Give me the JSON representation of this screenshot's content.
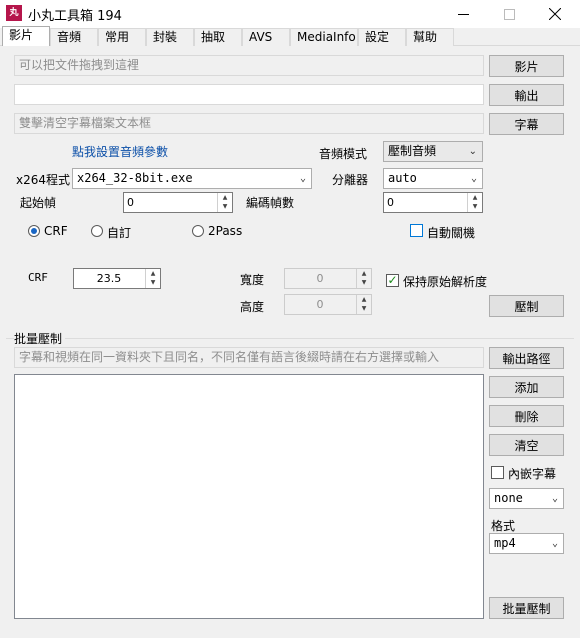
{
  "window": {
    "icon_text": "丸",
    "title": "小丸工具箱 194"
  },
  "tabs": [
    "影片",
    "音頻",
    "常用",
    "封裝",
    "抽取",
    "AVS",
    "MediaInfo",
    "設定",
    "幫助"
  ],
  "video": {
    "input_placeholder": "可以把文件拖拽到這裡",
    "output_value": "",
    "subtitle_placeholder": "雙擊清空字幕檔案文本框",
    "btn_video": "影片",
    "btn_output": "輸出",
    "btn_subtitle": "字幕",
    "audio_params_link": "點我設置音頻參數",
    "audio_mode_label": "音頻模式",
    "audio_mode_value": "壓制音頻",
    "x264_label": "x264程式",
    "x264_value": "x264_32-8bit.exe",
    "splitter_label": "分離器",
    "splitter_value": "auto",
    "start_frame_label": "起始幀",
    "start_frame_value": "0",
    "encode_frames_label": "編碼幀數",
    "encode_frames_value": "0",
    "mode_crf": "CRF",
    "mode_custom": "自訂",
    "mode_2pass": "2Pass",
    "auto_shutdown": "自動關機",
    "crf_label": "CRF",
    "crf_value": "23.5",
    "width_label": "寬度",
    "width_value": "0",
    "height_label": "高度",
    "height_value": "0",
    "keep_res": "保持原始解析度",
    "btn_encode": "壓制"
  },
  "batch": {
    "group_title": "批量壓制",
    "hint_placeholder": "字幕和視頻在同一資料夾下且同名，不同名僅有語言後綴時請在右方選擇或輸入",
    "btn_output_path": "輸出路徑",
    "btn_add": "添加",
    "btn_delete": "刪除",
    "btn_clear": "清空",
    "embed_subs": "內嵌字幕",
    "sub_select": "none",
    "format_label": "格式",
    "format_value": "mp4",
    "btn_batch": "批量壓制"
  }
}
